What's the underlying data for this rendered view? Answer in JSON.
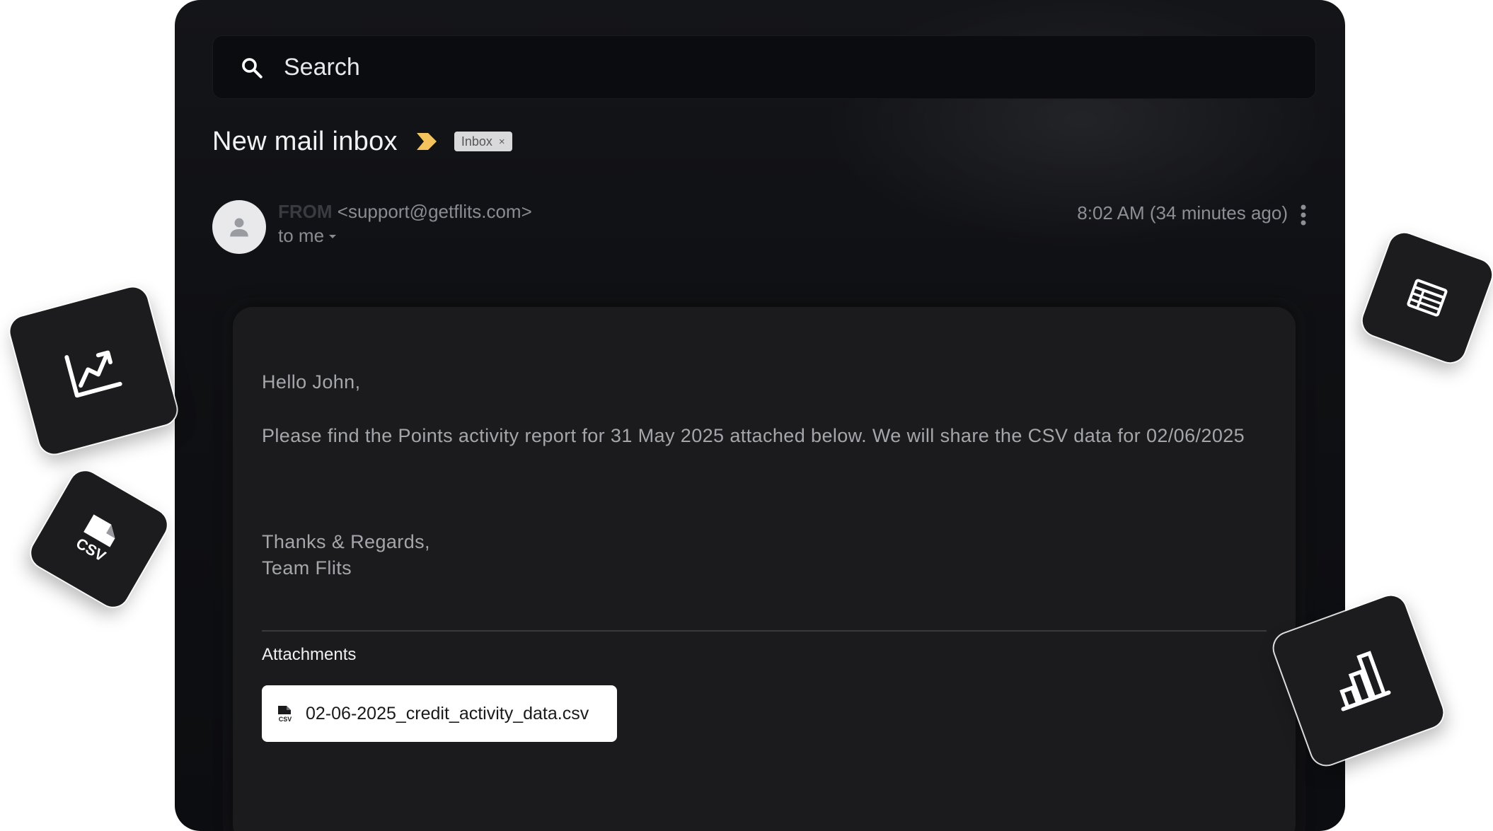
{
  "search": {
    "placeholder": "Search",
    "icon": "search-icon"
  },
  "header": {
    "title": "New mail inbox",
    "label_badge": "Inbox",
    "label_badge_close": "×",
    "important_color": "#f5c35b"
  },
  "message": {
    "from_label": "FROM",
    "from_email": "<support@getflits.com>",
    "to_label": "to me",
    "timestamp": "8:02 AM (34 minutes ago)",
    "greeting": "Hello John,",
    "body": "Please find the Points activity report for 31 May 2025 attached below. We will share the CSV data for 02/06/2025",
    "signoff_line1": "Thanks & Regards,",
    "signoff_line2": "Team Flits"
  },
  "attachments": {
    "heading": "Attachments",
    "files": [
      {
        "name": "02-06-2025_credit_activity_data.csv",
        "icon": "csv-file-icon"
      }
    ]
  },
  "decorative_tiles": [
    {
      "icon": "line-chart-icon"
    },
    {
      "icon": "csv-file-icon"
    },
    {
      "icon": "table-icon"
    },
    {
      "icon": "bar-chart-icon"
    }
  ]
}
